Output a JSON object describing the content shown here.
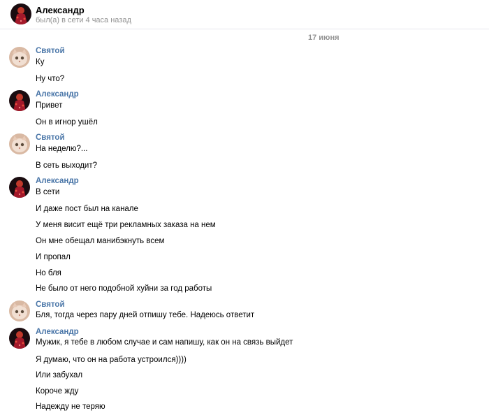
{
  "header": {
    "name": "Александр",
    "status": "был(а) в сети 4 часа назад"
  },
  "date_separator": "17 июня",
  "groups": [
    {
      "author": "Святой",
      "avatar": "cat-avatar",
      "messages": [
        "Ку",
        "Ну что?"
      ]
    },
    {
      "author": "Александр",
      "avatar": "red-avatar",
      "messages": [
        "Привет",
        "Он в игнор ушёл"
      ]
    },
    {
      "author": "Святой",
      "avatar": "cat-avatar",
      "messages": [
        "На неделю?...",
        "В сеть выходит?"
      ]
    },
    {
      "author": "Александр",
      "avatar": "red-avatar",
      "messages": [
        "В сети",
        "И даже пост был на канале",
        "У меня висит ещё три рекламных заказа на нем",
        "Он мне обещал манибэкнуть всем",
        "И пропал",
        "Но бля",
        "Не было от него подобной хуйни за год работы"
      ]
    },
    {
      "author": "Святой",
      "avatar": "cat-avatar",
      "messages": [
        "Бля, тогда через пару дней отпишу тебе. Надеюсь ответит"
      ]
    },
    {
      "author": "Александр",
      "avatar": "red-avatar",
      "messages": [
        "Мужик, я тебе в любом случае и сам напишу, как он на связь выйдет",
        "Я думаю, что он на работа устроился))))",
        "Или забухал",
        "Короче жду",
        "Надежду не теряю"
      ]
    }
  ]
}
